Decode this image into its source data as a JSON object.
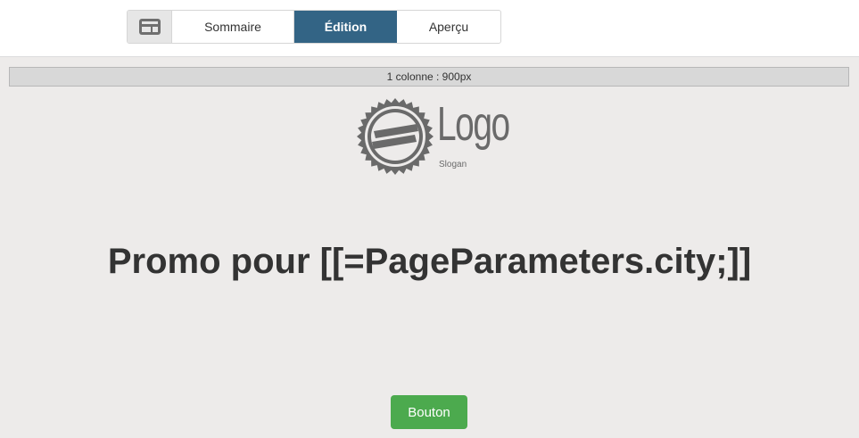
{
  "tabs": {
    "icon": "layout-icon",
    "items": [
      {
        "label": "Sommaire"
      },
      {
        "label": "Édition",
        "active": true
      },
      {
        "label": "Aperçu"
      }
    ]
  },
  "editor": {
    "column_label": "1 colonne : 900px",
    "logo": {
      "word": "Logo",
      "slogan": "Slogan",
      "icon": "seal-badge-icon"
    },
    "headline": "Promo pour [[=PageParameters.city;]]",
    "button_label": "Bouton"
  },
  "colors": {
    "tab_active": "#336485",
    "canvas_bg": "#edebea",
    "button_bg": "#4caa4e"
  }
}
